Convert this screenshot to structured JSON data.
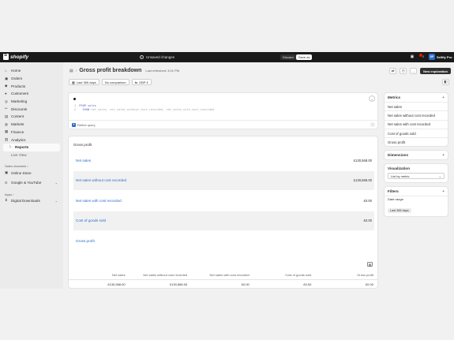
{
  "topbar": {
    "brand": "shopify",
    "unsaved_label": "Unsaved changes",
    "discard_label": "Discard",
    "save_label": "Save as",
    "store_initials": "SP",
    "store_name": "Sellify Pro"
  },
  "sidebar": {
    "items": [
      {
        "label": "Home",
        "icon": "home-icon",
        "glyph": "⌂"
      },
      {
        "label": "Orders",
        "icon": "orders-icon",
        "glyph": "▣"
      },
      {
        "label": "Products",
        "icon": "products-icon",
        "glyph": "◆"
      },
      {
        "label": "Customers",
        "icon": "customers-icon",
        "glyph": "●"
      },
      {
        "label": "Marketing",
        "icon": "marketing-icon",
        "glyph": "◎"
      },
      {
        "label": "Discounts",
        "icon": "discounts-icon",
        "glyph": "✂"
      },
      {
        "label": "Content",
        "icon": "content-icon",
        "glyph": "▤"
      },
      {
        "label": "Markets",
        "icon": "markets-icon",
        "glyph": "◍"
      },
      {
        "label": "Finance",
        "icon": "finance-icon",
        "glyph": "▦"
      },
      {
        "label": "Analytics",
        "icon": "analytics-icon",
        "glyph": "▥"
      }
    ],
    "reports_label": "Reports",
    "live_view_label": "Live View",
    "sales_channels_label": "Sales channels",
    "online_store_label": "Online Store",
    "google_youtube_label": "Google & YouTube",
    "apps_label": "Apps",
    "digital_downloads_label": "Digital Downloads"
  },
  "header": {
    "title": "Gross profit breakdown",
    "refreshed": "Last refreshed: 3:01 PM",
    "new_exploration_label": "New exploration"
  },
  "filters": {
    "date_range": "Last 365 days",
    "comparison": "No comparison",
    "currency": "GBP £"
  },
  "query": {
    "line1_num": "1",
    "line1_kw": "FROM",
    "line1_rest": "sales",
    "line2_num": "2",
    "line2_kw": "SHOW",
    "line2_rest": "net_sales, net_sales_without_cost_recorded, net_sales_with_cost_recorded",
    "refine_label": "Refine query"
  },
  "chart_data": {
    "type": "bar",
    "title": "Gross profit",
    "categories": [
      "Net sales",
      "Net sales without cost recorded",
      "Net sales with cost recorded",
      "Cost of goods sold",
      "Gross profit"
    ],
    "values": [
      130568.0,
      130568.0,
      0.0,
      0.0,
      0.0
    ],
    "value_labels": [
      "£130,568.00",
      "£130,568.00",
      "£0.00",
      "£0.00",
      ""
    ]
  },
  "table": {
    "headers": [
      "Net sales",
      "Net sales without cost recorded",
      "Net sales with cost recorded",
      "Cost of goods sold",
      "Gross profit"
    ],
    "row": [
      "£130,568.00",
      "£130,568.00",
      "£0.00",
      "£0.00",
      "£0.00"
    ]
  },
  "right_panel": {
    "metrics_title": "Metrics",
    "metrics": [
      "Net sales",
      "Net sales without cost recorded",
      "Net sales with cost recorded",
      "Cost of goods sold",
      "Gross profit"
    ],
    "dimensions_title": "Dimensions",
    "visualization_title": "Visualization",
    "visualization_value": "List by metric",
    "filters_title": "Filters",
    "date_range_label": "Date range",
    "date_range_value": "Last 365 days"
  },
  "colors": {
    "topbar": "#1a1a1a",
    "link": "#2c6ecb",
    "notification": "#e51c00"
  }
}
